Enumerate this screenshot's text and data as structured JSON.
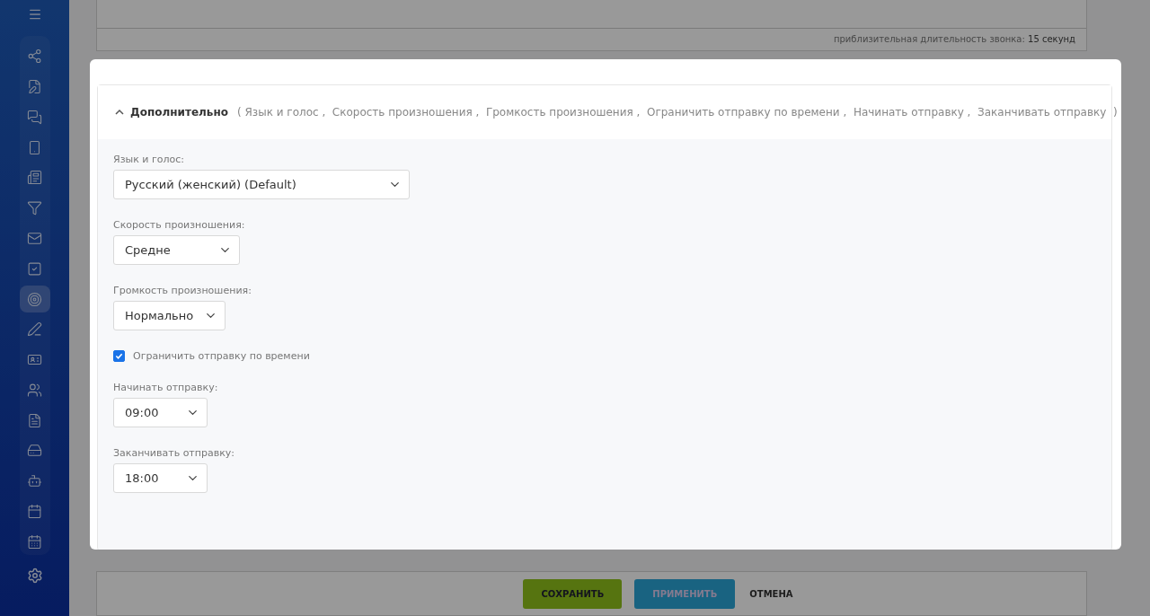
{
  "sidebar": {
    "items": [
      {
        "selected": false
      },
      {
        "selected": false
      },
      {
        "selected": false
      },
      {
        "selected": false
      },
      {
        "selected": false
      },
      {
        "selected": false
      },
      {
        "selected": false
      },
      {
        "selected": false
      },
      {
        "selected": true
      },
      {
        "selected": false
      },
      {
        "selected": false
      },
      {
        "selected": false
      },
      {
        "selected": false
      },
      {
        "selected": false
      },
      {
        "selected": false
      },
      {
        "selected": false
      },
      {
        "selected": false
      }
    ]
  },
  "background": {
    "duration_note": "приблизительная длительность звонка: **15 секунд**",
    "buttons": [
      {
        "label": "СОХРАНИТЬ",
        "kind": "save"
      },
      {
        "label": "ПРИМЕНИТЬ",
        "kind": "apply"
      },
      {
        "label": "ОТМЕНА",
        "kind": "cancel"
      }
    ]
  },
  "dialog": {
    "section": {
      "title": "Дополнительно",
      "expanded": true,
      "summary": "( Язык и голос ,  Скорость произношения ,  Громкость произношения ,  Ограничить отправку по времени ,  Начинать отправку ,  Заканчивать отправку  )",
      "fields": [
        {
          "kind": "select",
          "label": "Язык и голос:",
          "value": "Русский (женский) (Default)"
        },
        {
          "kind": "select",
          "label": "Скорость произношения:",
          "value": "Средне"
        },
        {
          "kind": "select",
          "label": "Громкость произношения:",
          "value": "Нормально"
        },
        {
          "kind": "checkbox",
          "label": "Ограничить отправку по времени",
          "checked": true
        },
        {
          "kind": "select",
          "label": "Начинать отправку:",
          "value": "09:00"
        },
        {
          "kind": "select",
          "label": "Заканчивать отправку:",
          "value": "18:00"
        }
      ]
    }
  }
}
